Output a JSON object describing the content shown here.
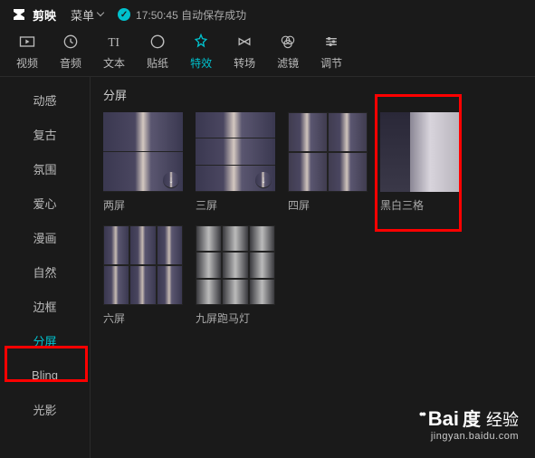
{
  "header": {
    "app_name": "剪映",
    "menu_label": "菜单",
    "save_time": "17:50:45",
    "save_status": "自动保存成功"
  },
  "toolbar": [
    {
      "id": "video",
      "label": "视频"
    },
    {
      "id": "audio",
      "label": "音频"
    },
    {
      "id": "text",
      "label": "文本"
    },
    {
      "id": "sticker",
      "label": "贴纸"
    },
    {
      "id": "effect",
      "label": "特效",
      "active": true
    },
    {
      "id": "trans",
      "label": "转场"
    },
    {
      "id": "filter",
      "label": "滤镜"
    },
    {
      "id": "adjust",
      "label": "调节"
    }
  ],
  "sidebar": [
    {
      "id": "motion",
      "label": "动感"
    },
    {
      "id": "retro",
      "label": "复古"
    },
    {
      "id": "mood",
      "label": "氛围"
    },
    {
      "id": "heart",
      "label": "爱心"
    },
    {
      "id": "comic",
      "label": "漫画"
    },
    {
      "id": "nature",
      "label": "自然"
    },
    {
      "id": "frame",
      "label": "边框"
    },
    {
      "id": "split",
      "label": "分屏",
      "active": true
    },
    {
      "id": "bling",
      "label": "Bling"
    },
    {
      "id": "light",
      "label": "光影"
    }
  ],
  "section_title": "分屏",
  "effects": [
    {
      "id": "two",
      "label": "两屏",
      "layout": "split2",
      "cells": 2,
      "download": true
    },
    {
      "id": "three",
      "label": "三屏",
      "layout": "split3",
      "cells": 3,
      "download": true
    },
    {
      "id": "four",
      "label": "四屏",
      "layout": "split4",
      "cells": 4,
      "download": false
    },
    {
      "id": "bw3",
      "label": "黑白三格",
      "layout": "bw3",
      "download": false
    },
    {
      "id": "six",
      "label": "六屏",
      "layout": "split6",
      "cells": 6,
      "download": false
    },
    {
      "id": "nine",
      "label": "九屏跑马灯",
      "layout": "split9",
      "cells": 9,
      "download": false
    }
  ],
  "watermark": {
    "brand": "Bai",
    "brand_suffix": "经验",
    "sub": "jingyan.baidu.com"
  },
  "download_glyph": "↓"
}
